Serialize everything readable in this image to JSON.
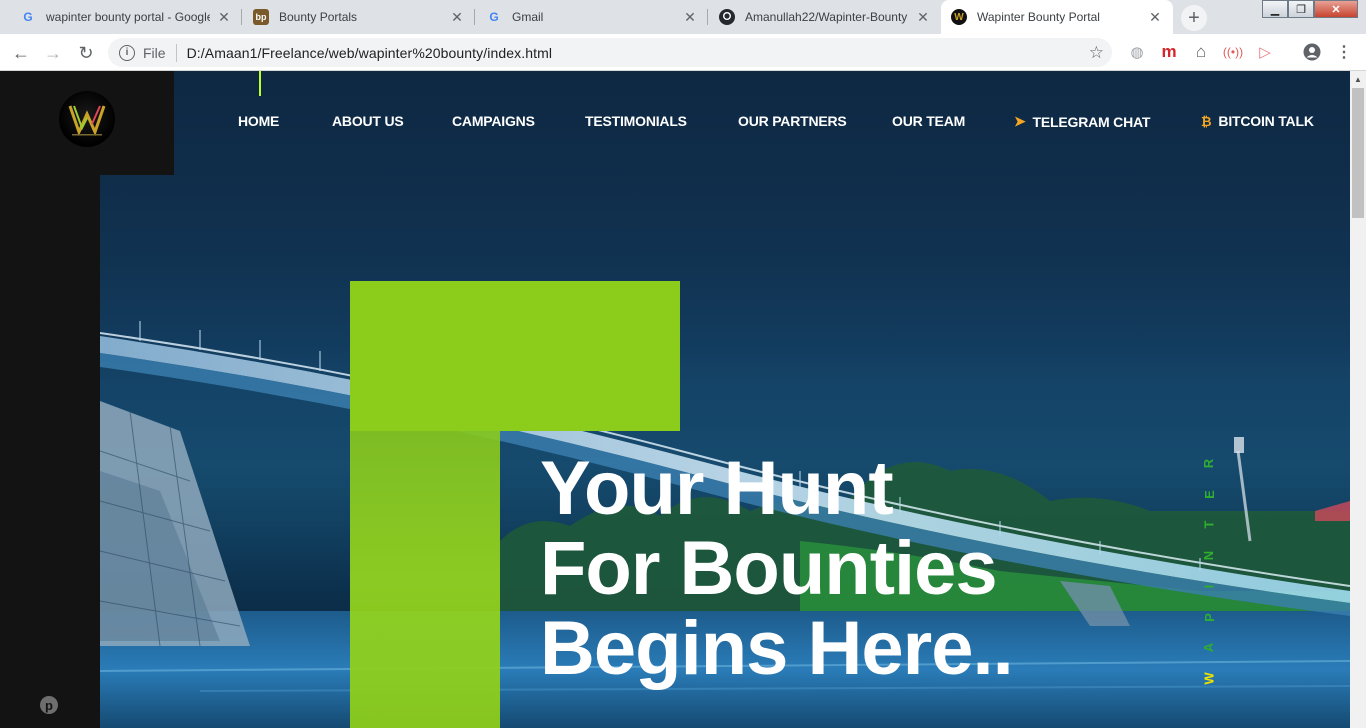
{
  "browser": {
    "tabs": [
      {
        "title": "wapinter bounty portal - Google",
        "favicon": "google-g-icon",
        "active": false
      },
      {
        "title": "Bounty Portals",
        "favicon": "bp-icon",
        "active": false
      },
      {
        "title": "Gmail",
        "favicon": "google-g-icon",
        "active": false
      },
      {
        "title": "Amanullah22/Wapinter-Bounty",
        "favicon": "github-icon",
        "active": false
      },
      {
        "title": "Wapinter Bounty Portal",
        "favicon": "wapinter-icon",
        "active": true
      }
    ],
    "address": {
      "scheme": "File",
      "url": "D:/Amaan1/Freelance/web/wapinter%20bounty/index.html"
    },
    "extensions": [
      "globe-icon",
      "m-extension-icon",
      "home-icon",
      "broadcast-icon",
      "cast-icon",
      "account-icon",
      "menu-dots-icon"
    ]
  },
  "site": {
    "logo_alt": "W",
    "nav": [
      {
        "label": "HOME"
      },
      {
        "label": "ABOUT US"
      },
      {
        "label": "CAMPAIGNS"
      },
      {
        "label": "TESTIMONIALS"
      },
      {
        "label": "OUR PARTNERS"
      },
      {
        "label": "OUR TEAM"
      },
      {
        "label": "TELEGRAM CHAT",
        "icon": "telegram-icon"
      },
      {
        "label": "BITCOIN TALK",
        "icon": "bitcoin-icon"
      }
    ],
    "hero": {
      "line1": "Your Hunt",
      "line2": "For Bounties",
      "line3": "Begins Here.."
    },
    "vertical_word": [
      "W",
      "A",
      "P",
      "I",
      "N",
      "T",
      "E",
      "R"
    ],
    "colors": {
      "accent_green": "#8ccc1a",
      "sidebar": "#131313",
      "icon_orange": "#f5a623"
    }
  }
}
